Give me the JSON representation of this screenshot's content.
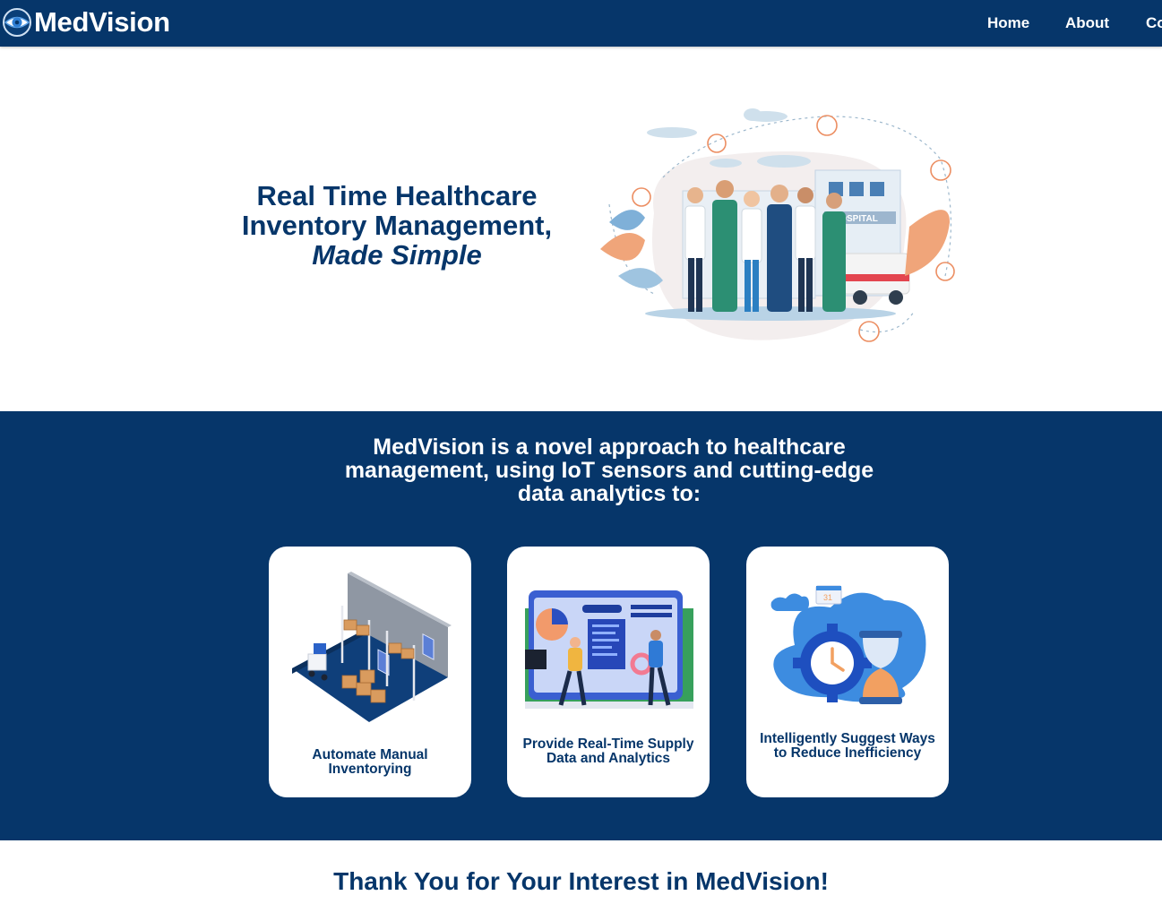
{
  "brand": {
    "name": "MedVision",
    "logo_icon": "eye-icon"
  },
  "nav": {
    "links": [
      {
        "label": "Home"
      },
      {
        "label": "About"
      },
      {
        "label": "Co"
      }
    ]
  },
  "hero": {
    "title_line1": "Real Time Healthcare",
    "title_line2": "Inventory Management,",
    "title_line3": "Made Simple",
    "illustration": "hospital-staff-illustration"
  },
  "features": {
    "heading": "MedVision is a novel approach to healthcare management, using IoT sensors and cutting-edge data analytics to:",
    "cards": [
      {
        "label": "Automate Manual Inventorying",
        "icon": "warehouse-illustration"
      },
      {
        "label": "Provide Real-Time Supply Data and Analytics",
        "icon": "dashboard-analytics-illustration"
      },
      {
        "label": "Intelligently Suggest Ways to Reduce Inefficiency",
        "icon": "gear-clock-hourglass-illustration"
      }
    ]
  },
  "footer_heading": "Thank You for Your Interest in MedVision!",
  "calendar_day": "31",
  "colors": {
    "primary": "#06366a",
    "background": "#ffffff",
    "card": "#ffffff",
    "accent_orange": "#f0a57a",
    "accent_blue": "#3d8ce0"
  }
}
